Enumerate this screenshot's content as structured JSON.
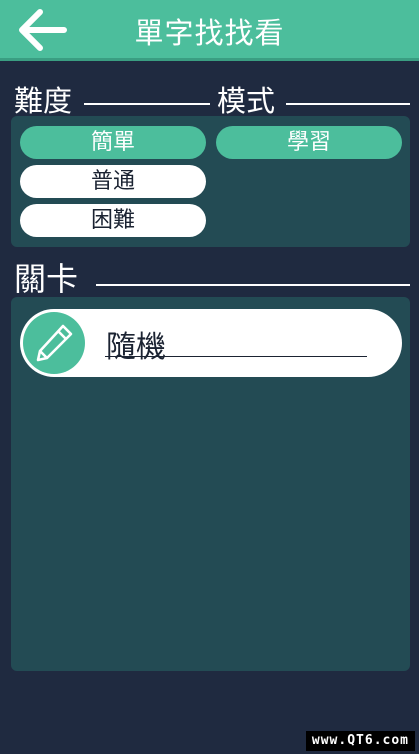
{
  "header": {
    "title": "單字找找看",
    "back_icon": "arrow-left-icon",
    "color": "#4cbe9c"
  },
  "difficulty": {
    "label": "難度",
    "options": [
      {
        "label": "簡單",
        "selected": true
      },
      {
        "label": "普通",
        "selected": false
      },
      {
        "label": "困難",
        "selected": false
      }
    ]
  },
  "mode": {
    "label": "模式",
    "options": [
      {
        "label": "學習",
        "selected": true
      }
    ]
  },
  "levels": {
    "label": "關卡",
    "items": [
      {
        "label": "隨機",
        "icon": "pencil-icon"
      }
    ]
  },
  "watermark": "www.QT6.com",
  "colors": {
    "background": "#1f2a40",
    "panel": "#234b54",
    "accent": "#4cbe9c"
  }
}
